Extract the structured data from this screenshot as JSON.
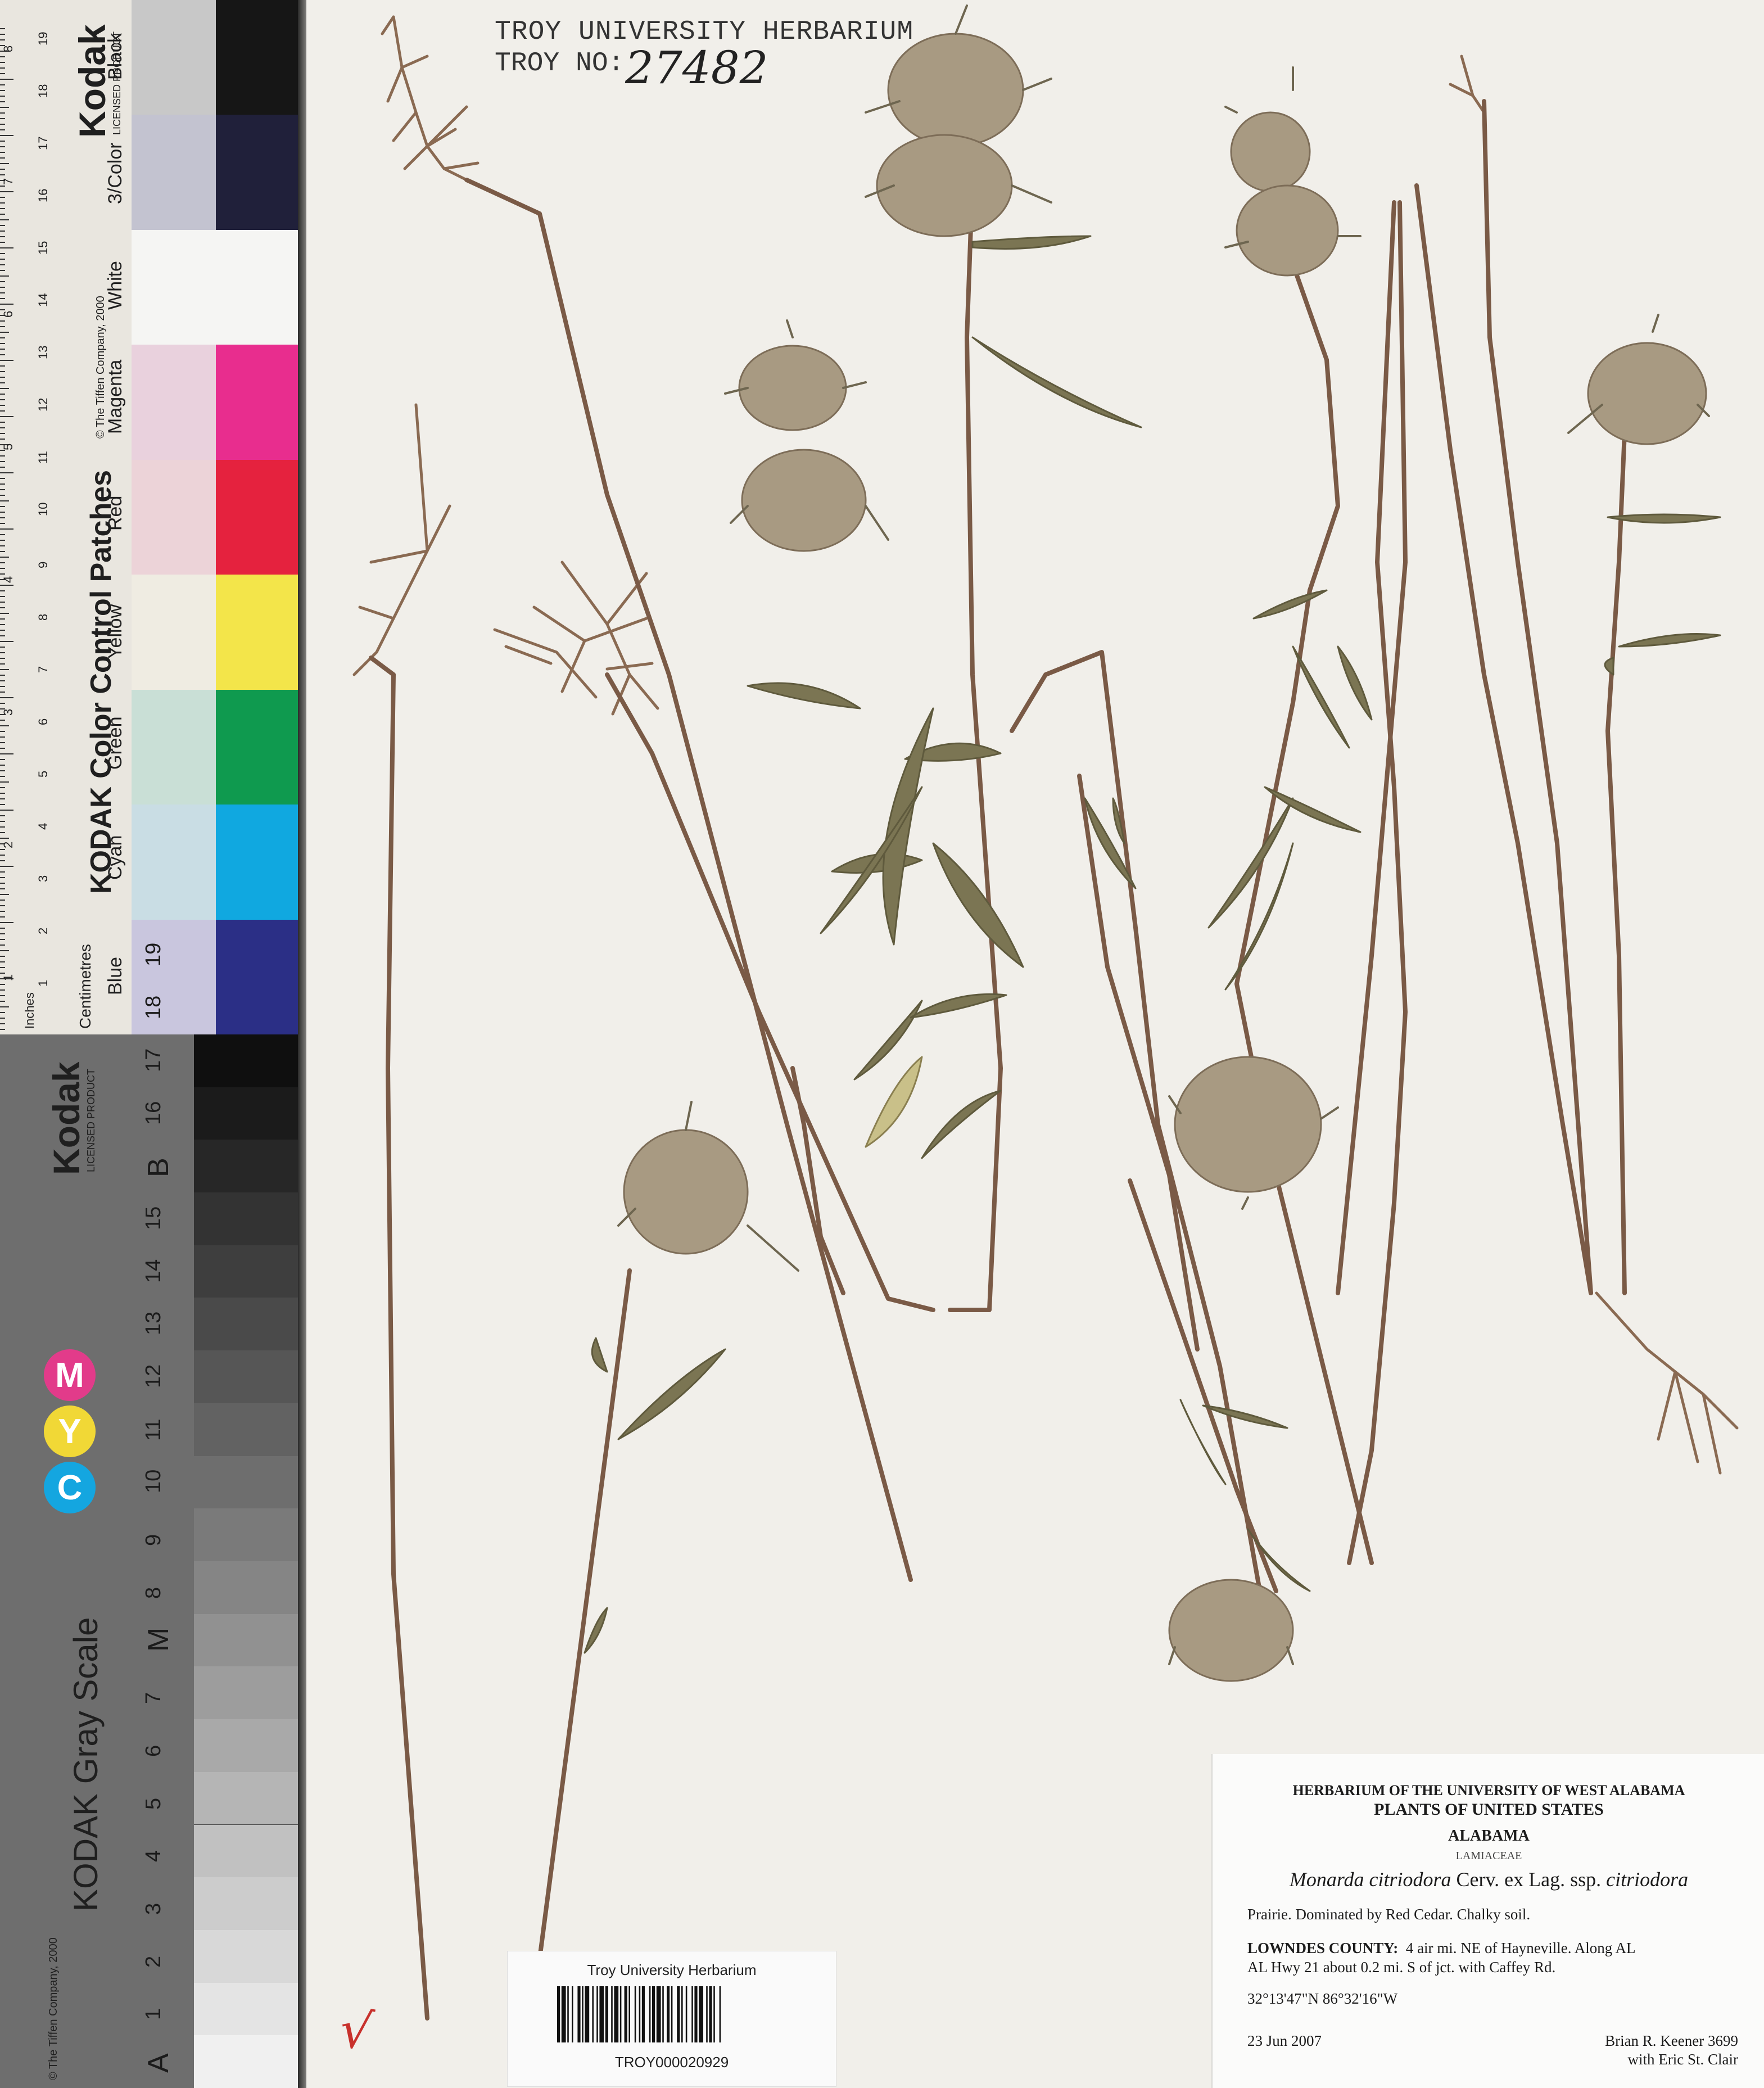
{
  "colors": {
    "sheet": "#f1efea",
    "stem": "#7a5a46",
    "leaf": "#78714f",
    "flower": "#a99a82"
  },
  "color_strip": {
    "brand": "Kodak",
    "licensed": "LICENSED PRODUCT",
    "title": "KODAK Color Control Patches",
    "copyright": "© The Tiffen Company, 2000",
    "unit_inches": "Inches",
    "unit_cm": "Centimetres",
    "patches": [
      {
        "name": "Blue",
        "light": "#c9c6de",
        "dark": "#2b2f86"
      },
      {
        "name": "Cyan",
        "light": "#c9dde4",
        "dark": "#10a8e0"
      },
      {
        "name": "Green",
        "light": "#c9dfd6",
        "dark": "#0f9a4f"
      },
      {
        "name": "Yellow",
        "light": "#efece2",
        "dark": "#f3e54a"
      },
      {
        "name": "Red",
        "light": "#ecd3d8",
        "dark": "#e5223e"
      },
      {
        "name": "Magenta",
        "light": "#e9d1dd",
        "dark": "#e82d8e"
      },
      {
        "name": "White",
        "light": "#f5f5f3",
        "dark": "#f5f5f3"
      },
      {
        "name": "3/Color",
        "light": "#c3c3d0",
        "dark": "#20203a"
      },
      {
        "name": "Black",
        "light": "#c8c8c8",
        "dark": "#161616"
      }
    ],
    "cm_numbers": [
      "1",
      "2",
      "3",
      "4",
      "5",
      "6",
      "7",
      "8",
      "9",
      "10",
      "11",
      "12",
      "13",
      "14",
      "15",
      "16",
      "17",
      "18",
      "19"
    ],
    "inch_numbers": [
      "1",
      "2",
      "3",
      "4",
      "5",
      "6",
      "7",
      "8"
    ]
  },
  "gray_strip": {
    "brand": "Kodak",
    "licensed": "LICENSED PRODUCT",
    "title": "KODAK Gray Scale",
    "copyright": "© The Tiffen Company, 2000",
    "letters": [
      "C",
      "Y",
      "M"
    ],
    "markers": [
      "A",
      "M",
      "B"
    ],
    "numbers": [
      "1",
      "2",
      "3",
      "4",
      "5",
      "6",
      "7",
      "8",
      "9",
      "10",
      "11",
      "12",
      "13",
      "14",
      "15",
      "16",
      "17",
      "18",
      "19"
    ]
  },
  "stamp": {
    "title": "TROY UNIVERSITY HERBARIUM",
    "number_label": "TROY NO:",
    "number": "27482"
  },
  "barcode": {
    "title": "Troy University Herbarium",
    "code": "TROY000020929"
  },
  "label": {
    "herbarium": "HERBARIUM OF THE UNIVERSITY OF WEST ALABAMA",
    "series": "PLANTS OF UNITED STATES",
    "state": "ALABAMA",
    "family": "LAMIACEAE",
    "genus_species": "Monarda citriodora",
    "authority": "Cerv. ex Lag. ssp.",
    "subspecies": "citriodora",
    "habitat": "Prairie.  Dominated by Red Cedar.  Chalky soil.",
    "county": "LOWNDES COUNTY:",
    "locality_1": "4 air mi. NE of Hayneville.  Along AL",
    "locality_2": "AL Hwy 21 about 0.2 mi. S of jct. with Caffey Rd.",
    "coords": "32°13'47\"N 86°32'16\"W",
    "date": "23 Jun 2007",
    "collector": "Brian R. Keener 3699",
    "with": "with Eric St. Clair"
  },
  "specimen": {
    "name": "Monarda citriodora specimen"
  }
}
